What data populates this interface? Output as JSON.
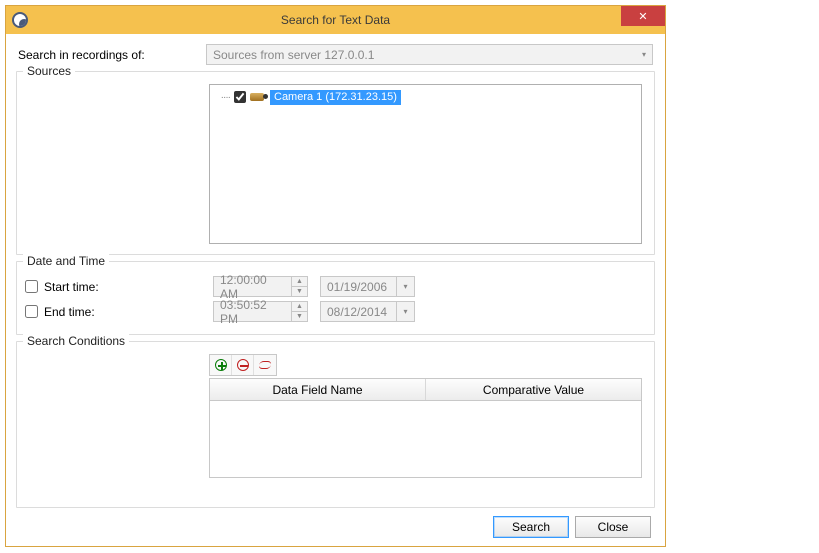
{
  "window": {
    "title": "Search for Text Data"
  },
  "server": {
    "label": "Search in recordings of:",
    "value": "Sources from server 127.0.0.1"
  },
  "sources": {
    "legend": "Sources",
    "items": [
      {
        "label": "Camera 1 (172.31.23.15)",
        "checked": true
      }
    ]
  },
  "datetime": {
    "legend": "Date and Time",
    "start": {
      "label": "Start time:",
      "time": "12:00:00 AM",
      "date": "01/19/2006"
    },
    "end": {
      "label": "End time:",
      "time": "03:50:52 PM",
      "date": "08/12/2014"
    }
  },
  "conditions": {
    "legend": "Search Conditions",
    "columns": {
      "field": "Data Field Name",
      "value": "Comparative Value"
    }
  },
  "footer": {
    "search": "Search",
    "close": "Close"
  }
}
